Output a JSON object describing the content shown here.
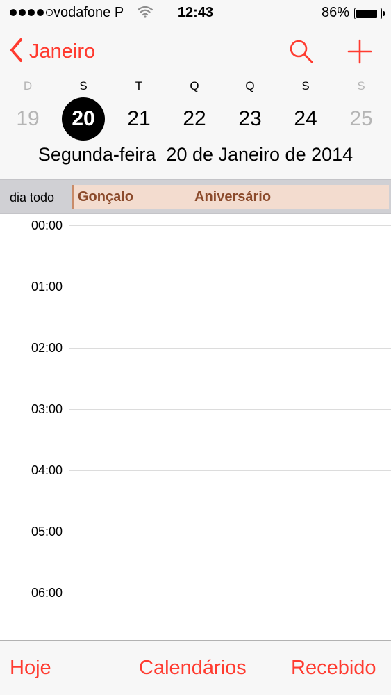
{
  "status_bar": {
    "carrier": "vodafone P",
    "time": "12:43",
    "battery_percent": "86%",
    "battery_level": 0.86,
    "signal_bars_filled": 4,
    "signal_bars_total": 5
  },
  "nav": {
    "back_label": "Janeiro",
    "back_icon": "chevron-left-icon",
    "search_icon": "search-icon",
    "add_icon": "plus-icon",
    "accent_color": "#ff3b30"
  },
  "week": {
    "days": [
      {
        "letter": "D",
        "number": "19"
      },
      {
        "letter": "S",
        "number": "20"
      },
      {
        "letter": "T",
        "number": "21"
      },
      {
        "letter": "Q",
        "number": "22"
      },
      {
        "letter": "Q",
        "number": "23"
      },
      {
        "letter": "S",
        "number": "24"
      },
      {
        "letter": "S",
        "number": "25"
      }
    ],
    "selected_index": 1
  },
  "date_title": "Segunda-feira  20 de Janeiro de 2014",
  "all_day": {
    "label": "dia todo",
    "event": {
      "name": "Gonçalo",
      "type": "Aniversário",
      "color": "#f3dccf",
      "text_color": "#8b4a2b"
    }
  },
  "timeline": {
    "hours": [
      "00:00",
      "01:00",
      "02:00",
      "03:00",
      "04:00",
      "05:00",
      "06:00"
    ]
  },
  "tab_bar": {
    "today": "Hoje",
    "calendars": "Calendários",
    "inbox": "Recebido"
  }
}
